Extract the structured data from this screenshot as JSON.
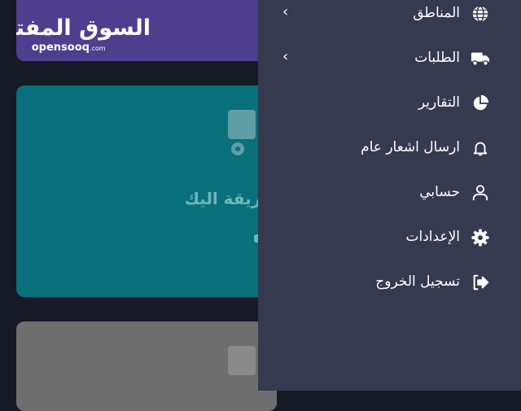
{
  "logo": {
    "arabic": "السوق المفتوح",
    "latin": "opensooq",
    "suffix": ".com"
  },
  "banner": {
    "text": "طريقة اليك"
  },
  "menu": {
    "items": [
      {
        "label": "المناطق",
        "icon": "globe-icon",
        "expandable": true
      },
      {
        "label": "الطلبات",
        "icon": "truck-icon",
        "expandable": true
      },
      {
        "label": "التقارير",
        "icon": "pie-chart-icon",
        "expandable": false
      },
      {
        "label": "ارسال اشعار عام",
        "icon": "bell-icon",
        "expandable": false
      },
      {
        "label": "حسابي",
        "icon": "user-icon",
        "expandable": false
      },
      {
        "label": "الإعدادات",
        "icon": "gear-icon",
        "expandable": false
      },
      {
        "label": "تسجيل الخروج",
        "icon": "logout-icon",
        "expandable": false
      }
    ],
    "chevron": "‹"
  },
  "colors": {
    "background": "#161a26",
    "drawer": "#353a4f",
    "card_purple": "#4d3f8e",
    "card_teal": "#08707a",
    "card_gray": "#6e6e6e",
    "icon_tint": "#ffffff"
  }
}
